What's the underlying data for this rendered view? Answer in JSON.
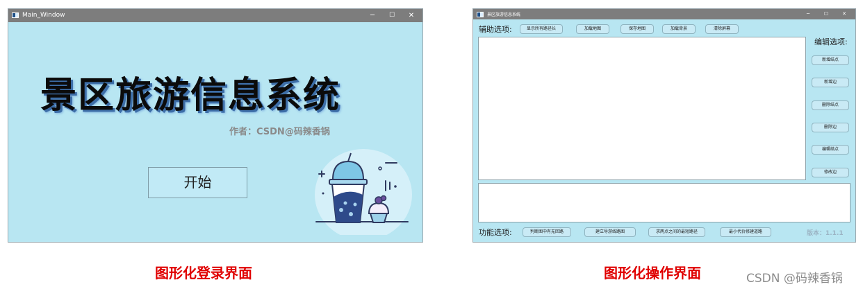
{
  "login_window": {
    "title": "Main_Window",
    "controls": {
      "minimize": "─",
      "maximize": "☐",
      "close": "✕"
    },
    "heading": "景区旅游信息系统",
    "author": "作者：CSDN@码辣香锅",
    "start_button": "开始"
  },
  "main_window": {
    "title": "景区旅游信息系统",
    "controls": {
      "minimize": "─",
      "maximize": "☐",
      "close": "✕"
    },
    "aux_label": "辅助选项:",
    "aux_buttons": [
      "显示所有路径长",
      "加载地图",
      "保存地图",
      "加载背景",
      "清除屏幕"
    ],
    "edit_label": "编辑选项:",
    "edit_buttons": [
      "新增结点",
      "新增边",
      "删除结点",
      "删除边",
      "编辑结点",
      "修改边"
    ],
    "func_label": "功能选项:",
    "func_buttons": [
      "判断图中有无回路",
      "建立导游线路图",
      "求两点之间的最短路径",
      "最小代价修建道路"
    ],
    "version": "版本：1.1.1"
  },
  "captions": {
    "login": "图形化登录界面",
    "main": "图形化操作界面"
  },
  "watermark": "CSDN @码辣香锅",
  "colors": {
    "window_bg": "#b8e6f2",
    "titlebar": "#7d7d7d",
    "caption": "#e00000",
    "heading_shadow": "#3d6ea8"
  }
}
